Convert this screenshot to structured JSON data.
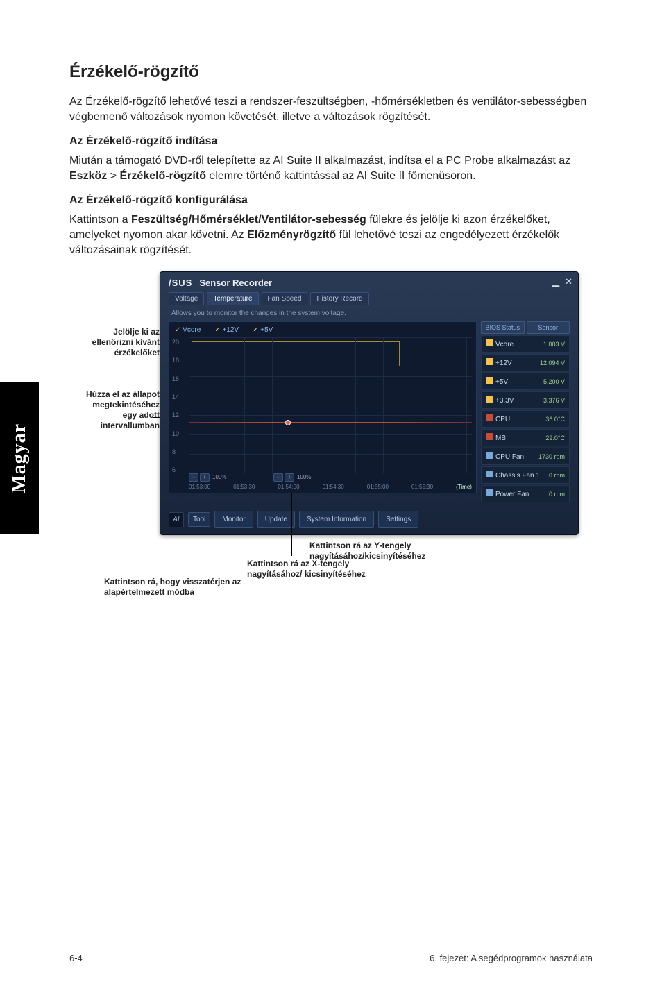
{
  "side_tab": "Magyar",
  "title": "Érzékelő-rögzítő",
  "intro": "Az Érzékelő-rögzítő lehetővé teszi a rendszer-feszültségben, -hőmérsékletben és ventilátor-sebességben végbemenő változások nyomon követését, illetve a változások rögzítését.",
  "sub_launch": "Az Érzékelő-rögzítő indítása",
  "launch": {
    "a": "Miután a támogató DVD-ről telepítette az AI Suite II alkalmazást, indítsa el a PC Probe alkalmazást az ",
    "tool": "Eszköz",
    "gt": " > ",
    "item": "Érzékelő-rögzítő",
    "b": " elemre történő kattintással az AI Suite II főmenüsoron."
  },
  "sub_config": "Az Érzékelő-rögzítő konfigurálása",
  "config": {
    "a": "Kattintson a ",
    "tabs": "Feszültség/Hőmérséklet/Ventilátor-sebesség",
    "b": " fülekre és jelölje ki azon érzékelőket, amelyeket nyomon akar követni. Az ",
    "history": "Előzményrögzítő",
    "c": " fül lehetővé teszi az engedélyezett érzékelők változásainak rögzítését."
  },
  "annotations": {
    "select_sensors": "Jelölje ki az ellenőrizni kívánt érzékelőket",
    "drag": "Húzza el az állapot megtekintéséhez egy adott intervallumban",
    "y_zoom": "Kattintson rá az Y-tengely nagyításához/kicsinyítéséhez",
    "x_zoom": "Kattintson rá az X-tengely nagyításához/ kicsinyítéséhez",
    "reset": "Kattintson rá, hogy visszatérjen az alapértelmezett módba"
  },
  "app": {
    "brand": "/SUS",
    "title": "Sensor Recorder",
    "tabs": [
      "Voltage",
      "Temperature",
      "Fan Speed",
      "History Record"
    ],
    "description": "Allows you to monitor the changes in the system voltage.",
    "sensors": [
      "Vcore",
      "+12V",
      "+5V"
    ],
    "side_head": [
      "BIOS Status",
      "Sensor"
    ],
    "metrics": [
      {
        "name": "Vcore",
        "val": "1.003 V"
      },
      {
        "name": "+12V",
        "val": "12.094 V"
      },
      {
        "name": "+5V",
        "val": "5.200 V"
      },
      {
        "name": "+3.3V",
        "val": "3.376 V"
      },
      {
        "name": "CPU",
        "val": "36.0°C"
      },
      {
        "name": "MB",
        "val": "29.0°C"
      },
      {
        "name": "CPU Fan",
        "val": "1730 rpm"
      },
      {
        "name": "Chassis Fan 1",
        "val": "0 rpm"
      },
      {
        "name": "Power Fan",
        "val": "0 rpm"
      }
    ],
    "zoom_x": "100%",
    "zoom_y": "100%",
    "bottom": [
      "Tool",
      "Monitor",
      "Update",
      "System Information",
      "Settings"
    ]
  },
  "chart_data": {
    "type": "line",
    "y_ticks": [
      "20",
      "18",
      "16",
      "14",
      "12",
      "10",
      "8",
      "6"
    ],
    "x_ticks": [
      "01:53:00",
      "01:53:30",
      "01:54:00",
      "01:54:30",
      "01:55:00",
      "01:55:30"
    ],
    "x_unit": "(Time)",
    "series": [
      {
        "name": "+12V",
        "approx_value": 12.0
      }
    ]
  },
  "footer": {
    "page": "6-4",
    "chapter": "6. fejezet: A segédprogramok használata"
  }
}
